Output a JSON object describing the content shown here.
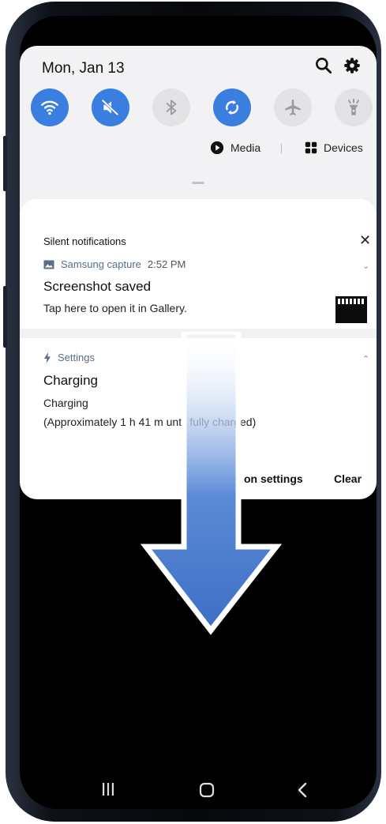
{
  "header": {
    "date": "Mon, Jan 13"
  },
  "quick_settings": [
    {
      "name": "wifi",
      "state": "on"
    },
    {
      "name": "mute",
      "state": "on"
    },
    {
      "name": "bluetooth",
      "state": "off"
    },
    {
      "name": "auto-rotate",
      "state": "on"
    },
    {
      "name": "airplane-mode",
      "state": "off"
    },
    {
      "name": "flashlight",
      "state": "off"
    }
  ],
  "media_row": {
    "media_label": "Media",
    "devices_label": "Devices"
  },
  "notifications": {
    "section_title": "Silent notifications",
    "items": [
      {
        "app": "Samsung capture",
        "time": "2:52 PM",
        "title": "Screenshot saved",
        "text": "Tap here to open it in Gallery."
      },
      {
        "app": "Settings",
        "title": "Charging",
        "text": "Charging",
        "text2": "(Approximately 1 h 41 m until fully charged)"
      }
    ],
    "settings_label": "on settings",
    "clear_label": "Clear"
  },
  "colors": {
    "accent": "#3a7ee0",
    "panel": "#f2f2f4",
    "card": "#ffffff",
    "arrow": "#3d6fc7"
  }
}
